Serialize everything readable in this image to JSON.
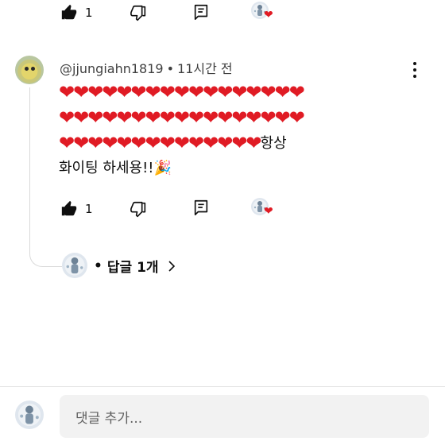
{
  "top_actions": {
    "like_count": "1"
  },
  "comment": {
    "author": "@jjungiahn1819",
    "separator": "•",
    "time": "11시간 전",
    "hearts_line1": "❤❤❤❤❤❤❤❤❤❤❤❤❤❤❤❤❤",
    "hearts_line2": "❤❤❤❤❤❤❤❤❤❤❤❤❤❤❤❤❤",
    "hearts_line3": "❤❤❤❤❤❤❤❤❤❤❤❤❤❤",
    "text_tail": "항상",
    "text_line4": "화이팅 하세용!!🎉",
    "like_count": "1"
  },
  "replies": {
    "dot": "•",
    "label": "답글 1개"
  },
  "composer": {
    "placeholder": "댓글 추가..."
  },
  "icons": {
    "like": "thumbs-up-icon",
    "dislike": "thumbs-down-icon",
    "reply": "comment-icon",
    "creator_heart": "creator-heart-icon",
    "more": "more-vertical-icon",
    "chevron": "chevron-right-icon"
  },
  "colors": {
    "heart": "#e01b24",
    "text": "#0f0f0f",
    "meta": "#3f3f3f"
  }
}
